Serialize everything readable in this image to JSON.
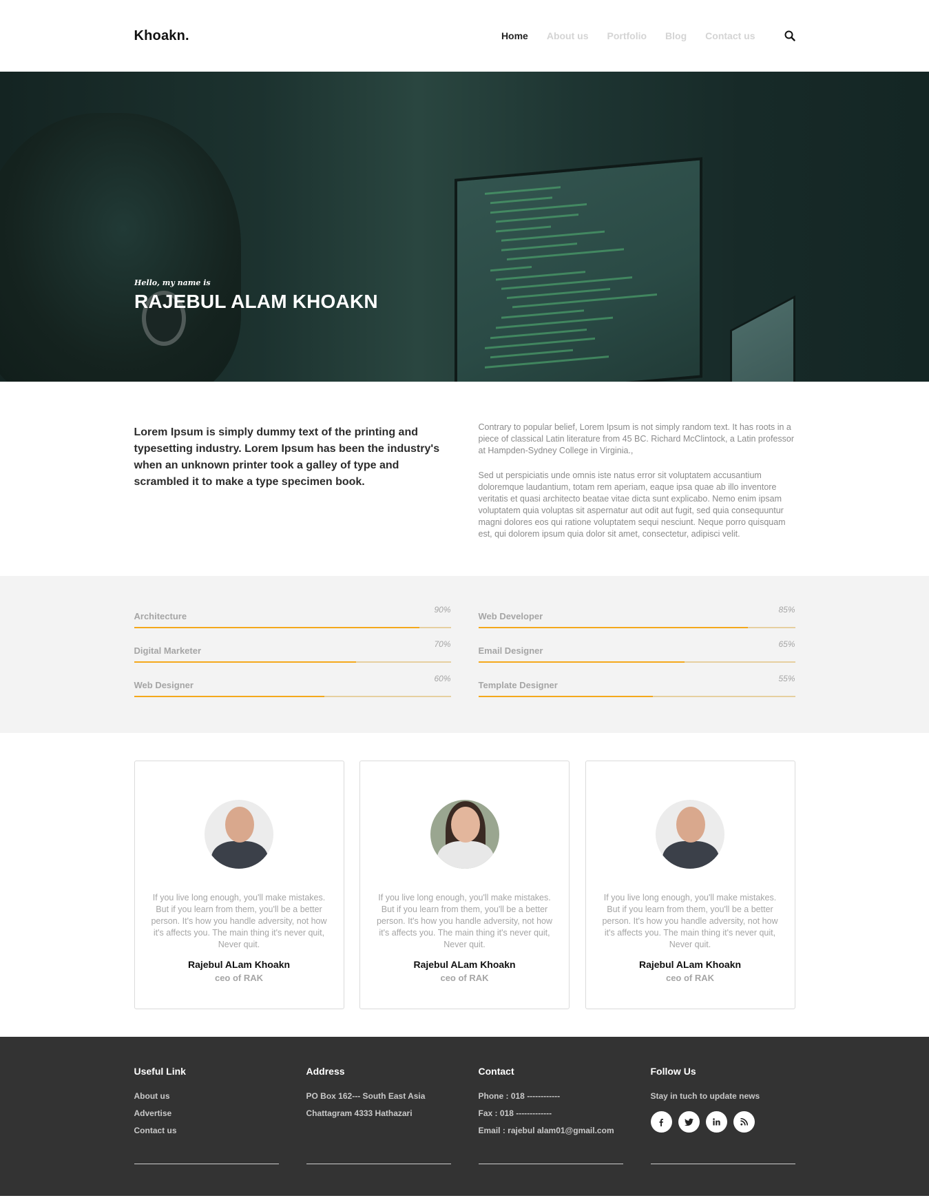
{
  "header": {
    "logo": "Khoakn.",
    "nav": [
      "Home",
      "About us",
      "Portfolio",
      "Blog",
      "Contact us"
    ],
    "active_index": 0
  },
  "hero": {
    "subtitle": "Hello, my name is",
    "title": "RAJEBUL ALAM KHOAKN"
  },
  "intro": {
    "lead": "Lorem Ipsum is simply dummy text of the printing and typesetting industry. Lorem Ipsum has been the industry's when an unknown printer took a galley of type and scrambled it to make a type specimen book.",
    "paragraph1": "Contrary to popular belief, Lorem Ipsum is not simply random text. It has roots in a piece of classical Latin literature from 45 BC. Richard McClintock, a Latin professor at Hampden-Sydney College in Virginia.,",
    "paragraph2": "Sed ut perspiciatis unde omnis iste natus error sit voluptatem accusantium doloremque laudantium, totam rem aperiam, eaque ipsa quae ab illo inventore veritatis et quasi architecto beatae vitae dicta sunt explicabo. Nemo enim ipsam voluptatem quia voluptas sit aspernatur aut odit aut fugit, sed quia consequuntur magni dolores eos qui ratione voluptatem sequi nesciunt. Neque porro quisquam est, qui dolorem ipsum quia dolor sit amet, consectetur, adipisci velit."
  },
  "skills": {
    "left": [
      {
        "label": "Architecture",
        "percent": "90%",
        "value": 90
      },
      {
        "label": "Digital Marketer",
        "percent": "70%",
        "value": 70
      },
      {
        "label": "Web Designer",
        "percent": "60%",
        "value": 60
      }
    ],
    "right": [
      {
        "label": "Web Developer",
        "percent": "85%",
        "value": 85
      },
      {
        "label": "Email Designer",
        "percent": "65%",
        "value": 65
      },
      {
        "label": "Template Designer",
        "percent": "55%",
        "value": 55
      }
    ],
    "accent_color": "#f4a81b"
  },
  "testimonials": [
    {
      "quote": "If you live long enough, you'll make mistakes. But if you learn from them, you'll be a better person. It's how you handle adversity, not how it's affects you. The main thing it's never quit, Never quit.",
      "name": "Rajebul ALam Khoakn",
      "role": "ceo of RAK",
      "avatar": "man-laughing"
    },
    {
      "quote": "If you live long enough, you'll make mistakes. But if you learn from them, you'll be a better person. It's how you handle adversity, not how it's affects you. The main thing it's never quit, Never quit.",
      "name": "Rajebul ALam Khoakn",
      "role": "ceo of RAK",
      "avatar": "woman-smiling"
    },
    {
      "quote": "If you live long enough, you'll make mistakes. But if you learn from them, you'll be a better person. It's how you handle adversity, not how it's affects you. The main thing it's never quit, Never quit.",
      "name": "Rajebul ALam Khoakn",
      "role": "ceo of RAK",
      "avatar": "man-laughing"
    }
  ],
  "footer": {
    "useful": {
      "title": "Useful Link",
      "items": [
        "About us",
        "Advertise",
        "Contact us"
      ]
    },
    "address": {
      "title": "Address",
      "items": [
        "PO Box 162--- South East Asia",
        "Chattagram 4333 Hathazari"
      ]
    },
    "contact": {
      "title": "Contact",
      "items": [
        "Phone : 018 ------------",
        "Fax : 018 -------------",
        "Email : rajebul alam01@gmail.com"
      ]
    },
    "follow": {
      "title": "Follow Us",
      "text": "Stay in tuch to update news",
      "icons": [
        "facebook-icon",
        "twitter-icon",
        "linkedin-icon",
        "rss-icon"
      ],
      "glyphs": [
        "f",
        "ᴛ",
        "in",
        "⦿"
      ]
    }
  }
}
